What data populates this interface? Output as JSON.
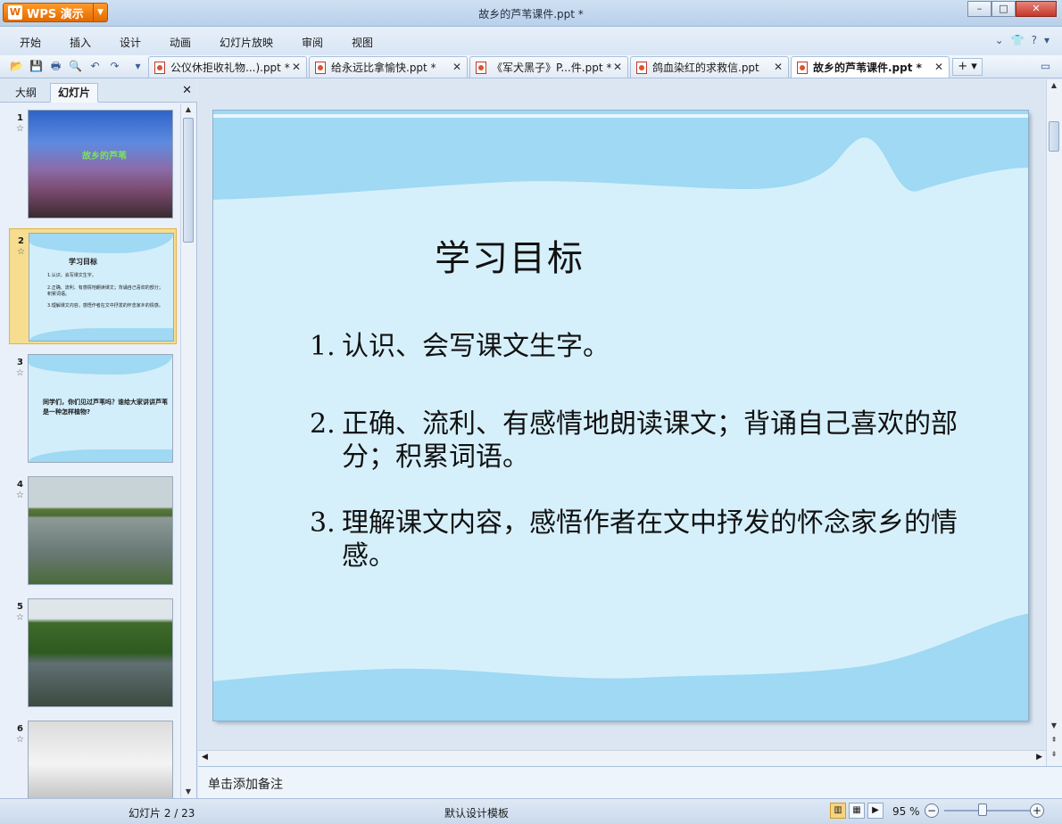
{
  "window": {
    "app_name": "WPS 演示",
    "title": "故乡的芦苇课件.ppt *",
    "controls": {
      "minimize": "–",
      "maximize": "□",
      "close": "✕"
    }
  },
  "menu": {
    "items": [
      "开始",
      "插入",
      "设计",
      "动画",
      "幻灯片放映",
      "审阅",
      "视图"
    ]
  },
  "doc_tabs": [
    {
      "label": "公仪休拒收礼物...).ppt *",
      "active": false
    },
    {
      "label": "给永远比拿愉快.ppt *",
      "active": false
    },
    {
      "label": "《军犬黑子》P...件.ppt *",
      "active": false
    },
    {
      "label": "鸽血染红的求救信.ppt",
      "active": false
    },
    {
      "label": "故乡的芦苇课件.ppt *",
      "active": true
    }
  ],
  "left_pane": {
    "tabs": [
      "大纲",
      "幻灯片"
    ],
    "active_tab": "幻灯片",
    "thumbnails": [
      {
        "number": "1",
        "star": "☆",
        "title": "故乡的芦苇"
      },
      {
        "number": "2",
        "star": "☆",
        "title": "学习目标",
        "lines": [
          "1.认识、会写课文生字。",
          "2.正确、流利、有感情地朗读课文；背诵自己喜欢的部分；积累词语。",
          "3.理解课文内容，感悟作者在文中抒发的怀念家乡的情感。"
        ]
      },
      {
        "number": "3",
        "star": "☆",
        "text": "同学们，你们见过芦苇吗？谁给大家讲讲芦苇是一种怎样植物?"
      },
      {
        "number": "4",
        "star": "☆"
      },
      {
        "number": "5",
        "star": "☆"
      },
      {
        "number": "6",
        "star": "☆"
      }
    ],
    "selected": "2"
  },
  "slide": {
    "title": "学习目标",
    "points": [
      {
        "num": "1.",
        "text": "认识、会写课文生字。"
      },
      {
        "num": "2.",
        "text": "正确、流利、有感情地朗读课文；背诵自己喜欢的部分；积累词语。"
      },
      {
        "num": "3.",
        "text": "理解课文内容，感悟作者在文中抒发的怀念家乡的情感。"
      }
    ]
  },
  "notes": {
    "placeholder": "单击添加备注"
  },
  "status": {
    "slide_counter": "幻灯片 2 / 23",
    "template": "默认设计模板",
    "zoom": "95 %",
    "zoom_fraction": 0.45
  },
  "colors": {
    "accent": "#e36a00",
    "selection": "#f6dd8f",
    "slide_bg": "#d6f0fb"
  }
}
